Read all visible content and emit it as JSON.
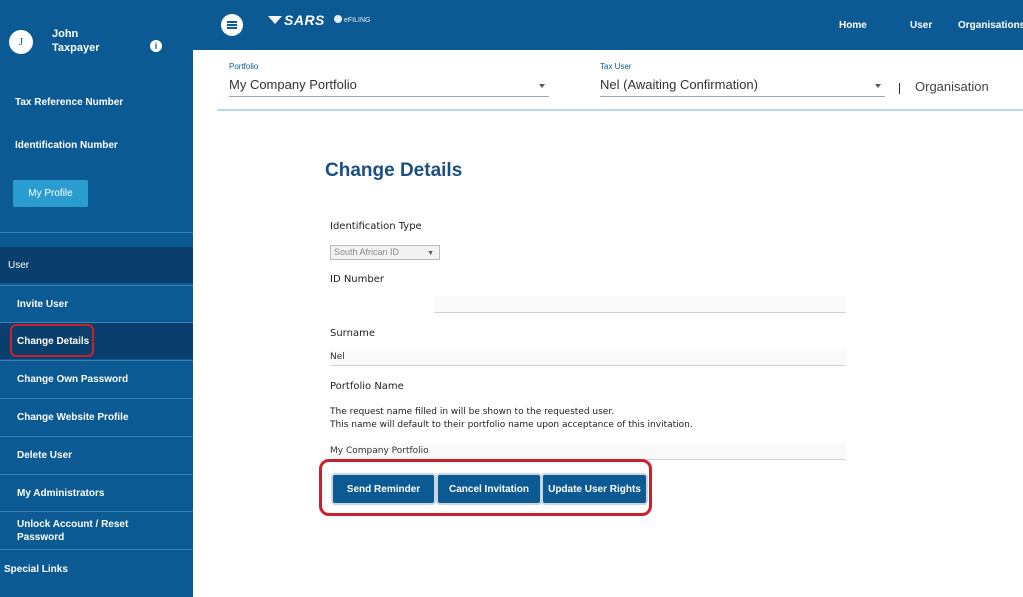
{
  "user": {
    "initial": "J",
    "name": "John Taxpayer"
  },
  "sidebar": {
    "tax_ref_label": "Tax Reference Number",
    "id_label": "Identification Number",
    "profile_button": "My Profile",
    "section_header": "User",
    "items": [
      {
        "label": "Invite User"
      },
      {
        "label": "Change Details",
        "active": true
      },
      {
        "label": "Change Own Password"
      },
      {
        "label": "Change Website Profile"
      },
      {
        "label": "Delete User"
      },
      {
        "label": "My Administrators"
      },
      {
        "label": "Unlock Account / Reset Password"
      }
    ],
    "special_links": "Special Links"
  },
  "topbar": {
    "logo": "SARS",
    "efiling": "eFILING",
    "nav": {
      "home": "Home",
      "user": "User",
      "organisations": "Organisations"
    }
  },
  "selectors": {
    "portfolio_label": "Portfolio",
    "portfolio_value": "My Company Portfolio",
    "tax_user_label": "Tax User",
    "tax_user_value": "Nel (Awaiting Confirmation)",
    "organisation": "Organisation"
  },
  "form": {
    "title": "Change Details",
    "id_type_label": "Identification Type",
    "id_type_value": "South African ID",
    "id_number_label": "ID Number",
    "id_number_value": "",
    "surname_label": "Surname",
    "surname_value": "Nel",
    "portfolio_name_label": "Portfolio Name",
    "info_line1": "The request name filled in will be shown to the requested user.",
    "info_line2": "This name will default to their portfolio name upon acceptance of this invitation.",
    "portfolio_name_value": "My Company Portfolio"
  },
  "buttons": {
    "send_reminder": "Send Reminder",
    "cancel_invitation": "Cancel Invitation",
    "update_user_rights": "Update User Rights"
  },
  "colors": {
    "primary": "#0b5a93",
    "dark_nav": "#0a3f6d",
    "highlight": "#c8202d",
    "title": "#1b4f82"
  }
}
